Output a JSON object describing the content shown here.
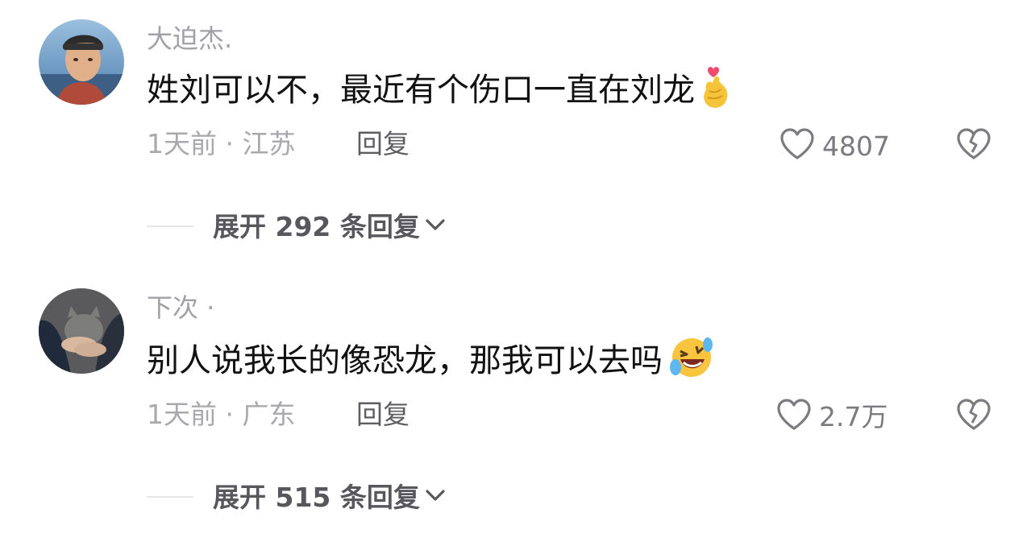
{
  "comments": [
    {
      "username": "大迫杰.",
      "text": "姓刘可以不，最近有个伤口一直在刘龙",
      "emoji_icon": "heart-hands-emoji",
      "time": "1天前",
      "separator": "·",
      "location": "江苏",
      "reply_label": "回复",
      "likes": "4807",
      "expand_label": "展开 292 条回复"
    },
    {
      "username": "下次 ·",
      "text": "别人说我长的像恐龙，那我可以去吗",
      "emoji_icon": "rolling-laughing-emoji",
      "time": "1天前",
      "separator": "·",
      "location": "广东",
      "reply_label": "回复",
      "likes": "2.7万",
      "expand_label": "展开 515 条回复"
    }
  ],
  "colors": {
    "username": "#a2a2a6",
    "text": "#111111",
    "meta": "#a9a9ad",
    "icon": "#7c7c80",
    "expand": "#58585c"
  }
}
